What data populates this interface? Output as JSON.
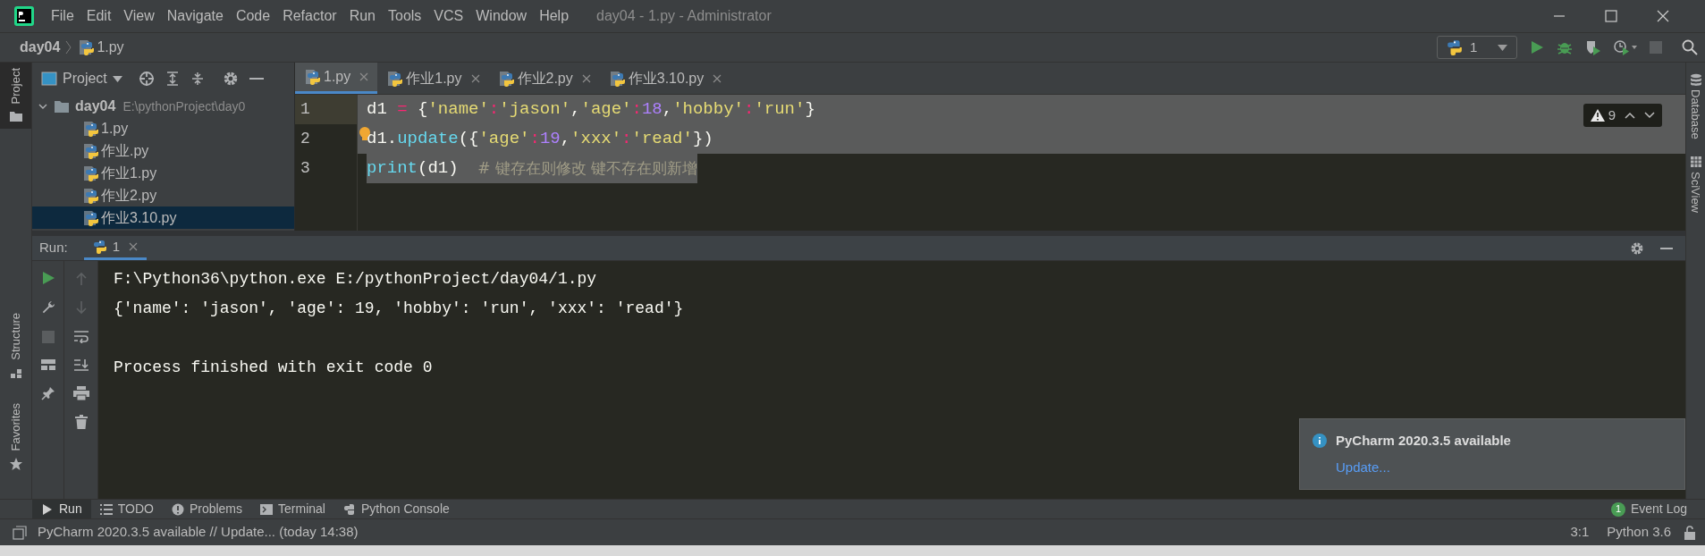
{
  "window": {
    "title": "day04 - 1.py - Administrator"
  },
  "menu": [
    "File",
    "Edit",
    "View",
    "Navigate",
    "Code",
    "Refactor",
    "Run",
    "Tools",
    "VCS",
    "Window",
    "Help"
  ],
  "breadcrumb": [
    "day04",
    "1.py"
  ],
  "run_config": {
    "label": "1"
  },
  "left_stripe": [
    "Project",
    "Structure",
    "Favorites"
  ],
  "right_stripe": [
    "Database",
    "SciView"
  ],
  "project_panel": {
    "title": "Project",
    "root": {
      "name": "day04",
      "path": "E:\\pythonProject\\day0",
      "expanded": true,
      "children": [
        {
          "name": "1.py",
          "selected": false
        },
        {
          "name": "作业.py",
          "selected": false
        },
        {
          "name": "作业1.py",
          "selected": false
        },
        {
          "name": "作业2.py",
          "selected": false
        },
        {
          "name": "作业3.10.py",
          "selected": true
        }
      ]
    }
  },
  "editor_tabs": [
    {
      "label": "1.py",
      "selected": true
    },
    {
      "label": "作业1.py",
      "selected": false
    },
    {
      "label": "作业2.py",
      "selected": false
    },
    {
      "label": "作业3.10.py",
      "selected": false
    }
  ],
  "editor": {
    "warnings": "9",
    "lines": [
      {
        "number": "1",
        "current": true,
        "selected": true,
        "tokens": [
          {
            "kind": "name",
            "text": "d1 "
          },
          {
            "kind": "op",
            "text": "="
          },
          {
            "kind": "punct",
            "text": " {"
          },
          {
            "kind": "string",
            "text": "'name'"
          },
          {
            "kind": "op",
            "text": ":"
          },
          {
            "kind": "string",
            "text": "'jason'"
          },
          {
            "kind": "punct",
            "text": ","
          },
          {
            "kind": "string",
            "text": "'age'"
          },
          {
            "kind": "op",
            "text": ":"
          },
          {
            "kind": "number",
            "text": "18"
          },
          {
            "kind": "punct",
            "text": ","
          },
          {
            "kind": "string",
            "text": "'hobby'"
          },
          {
            "kind": "op",
            "text": ":"
          },
          {
            "kind": "string",
            "text": "'run'"
          },
          {
            "kind": "punct",
            "text": "}"
          }
        ]
      },
      {
        "number": "2",
        "current": false,
        "selected": true,
        "tokens": [
          {
            "kind": "name",
            "text": "d1."
          },
          {
            "kind": "builtin",
            "text": "update"
          },
          {
            "kind": "punct",
            "text": "({"
          },
          {
            "kind": "string",
            "text": "'age'"
          },
          {
            "kind": "op",
            "text": ":"
          },
          {
            "kind": "number",
            "text": "19"
          },
          {
            "kind": "punct",
            "text": ","
          },
          {
            "kind": "string",
            "text": "'xxx'"
          },
          {
            "kind": "op",
            "text": ":"
          },
          {
            "kind": "string",
            "text": "'read'"
          },
          {
            "kind": "punct",
            "text": "})"
          }
        ]
      },
      {
        "number": "3",
        "current": false,
        "selected": true,
        "tokens": [
          {
            "kind": "builtin",
            "text": "print"
          },
          {
            "kind": "punct",
            "text": "(d1)"
          },
          {
            "kind": "comment",
            "text": "# 键存在则修改 键不存在则新增"
          }
        ]
      }
    ]
  },
  "run_panel": {
    "title": "Run:",
    "tab": "1",
    "output_blocks": [
      [
        "F:\\Python36\\python.exe E:/pythonProject/day04/1.py",
        "{'name': 'jason', 'age': 19, 'hobby': 'run', 'xxx': 'read'}"
      ],
      [
        "Process finished with exit code 0"
      ]
    ]
  },
  "tool_tabs": [
    {
      "label": "Run",
      "kind": "run",
      "selected": true
    },
    {
      "label": "TODO",
      "kind": "todo",
      "selected": false
    },
    {
      "label": "Problems",
      "kind": "problems",
      "selected": false
    },
    {
      "label": "Terminal",
      "kind": "terminal",
      "selected": false
    },
    {
      "label": "Python Console",
      "kind": "console",
      "selected": false
    }
  ],
  "event_log": {
    "label": "Event Log",
    "count": "1"
  },
  "notification": {
    "title": "PyCharm 2020.3.5 available",
    "link": "Update..."
  },
  "status_bar": {
    "message": "PyCharm 2020.3.5 available // Update... (today 14:38)",
    "position": "3:1",
    "interpreter": "Python 3.6"
  }
}
